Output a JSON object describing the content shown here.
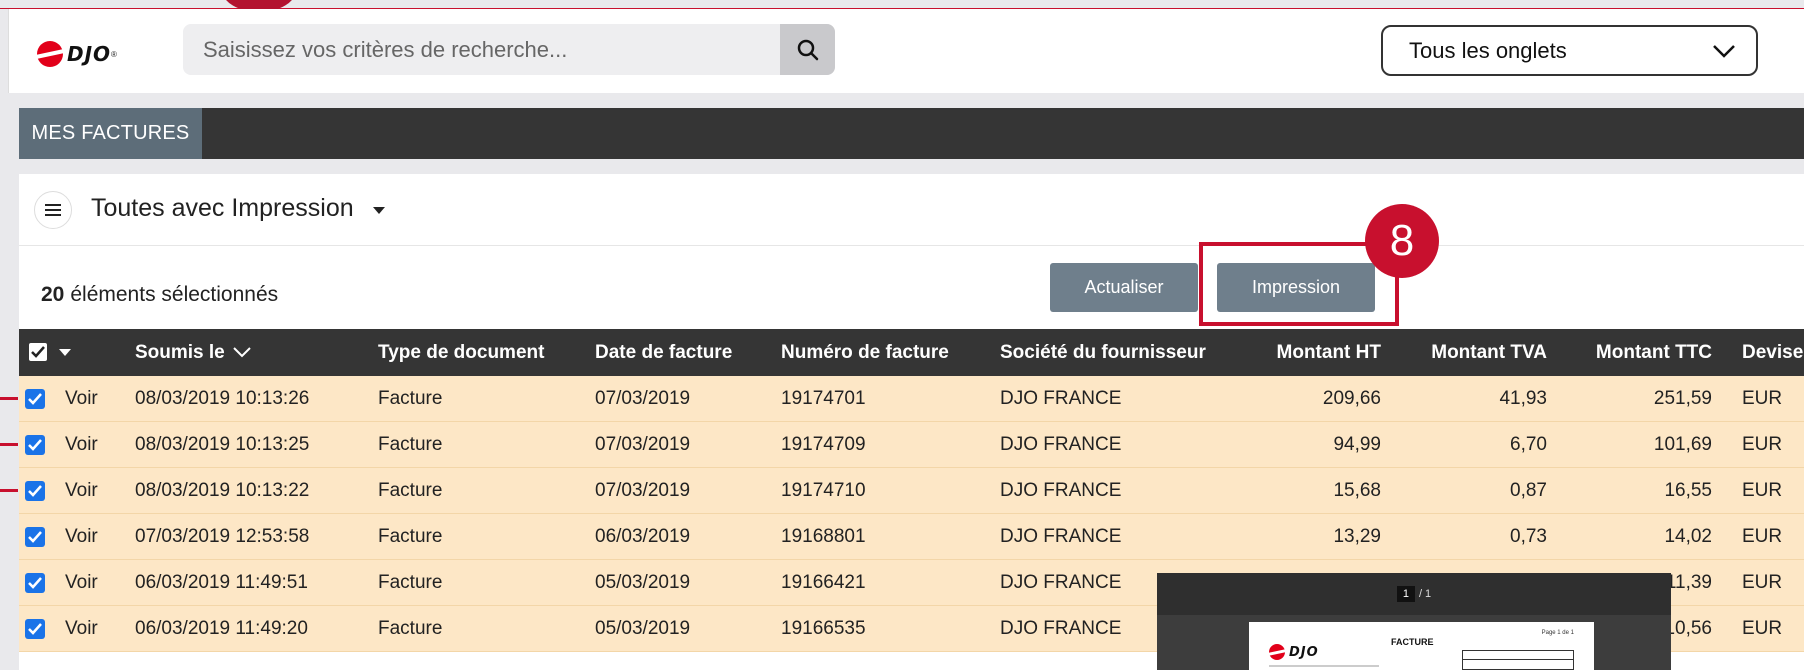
{
  "header": {
    "logo_text": "DJO",
    "search_placeholder": "Saisissez vos critères de recherche...",
    "tab_filter": "Tous les onglets"
  },
  "tabs": [
    {
      "label": "MES FACTURES"
    }
  ],
  "view": {
    "label": "Toutes avec Impression"
  },
  "selection": {
    "count": "20",
    "label": "éléments sélectionnés"
  },
  "buttons": {
    "refresh": "Actualiser",
    "print": "Impression"
  },
  "annotation": {
    "badge": "8"
  },
  "table": {
    "columns": {
      "submitted": "Soumis le",
      "doc_type": "Type de document",
      "invoice_date": "Date de facture",
      "invoice_number": "Numéro de facture",
      "supplier": "Société du fournisseur",
      "amount_ht": "Montant HT",
      "amount_tva": "Montant TVA",
      "amount_ttc": "Montant TTC",
      "currency": "Devise"
    },
    "rows": [
      {
        "view": "Voir",
        "submitted": "08/03/2019 10:13:26",
        "doc_type": "Facture",
        "invoice_date": "07/03/2019",
        "invoice_number": "19174701",
        "supplier": "DJO FRANCE",
        "ht": "209,66",
        "tva": "41,93",
        "ttc": "251,59",
        "currency": "EUR"
      },
      {
        "view": "Voir",
        "submitted": "08/03/2019 10:13:25",
        "doc_type": "Facture",
        "invoice_date": "07/03/2019",
        "invoice_number": "19174709",
        "supplier": "DJO FRANCE",
        "ht": "94,99",
        "tva": "6,70",
        "ttc": "101,69",
        "currency": "EUR"
      },
      {
        "view": "Voir",
        "submitted": "08/03/2019 10:13:22",
        "doc_type": "Facture",
        "invoice_date": "07/03/2019",
        "invoice_number": "19174710",
        "supplier": "DJO FRANCE",
        "ht": "15,68",
        "tva": "0,87",
        "ttc": "16,55",
        "currency": "EUR"
      },
      {
        "view": "Voir",
        "submitted": "07/03/2019 12:53:58",
        "doc_type": "Facture",
        "invoice_date": "06/03/2019",
        "invoice_number": "19168801",
        "supplier": "DJO FRANCE",
        "ht": "13,29",
        "tva": "0,73",
        "ttc": "14,02",
        "currency": "EUR"
      },
      {
        "view": "Voir",
        "submitted": "06/03/2019 11:49:51",
        "doc_type": "Facture",
        "invoice_date": "05/03/2019",
        "invoice_number": "19166421",
        "supplier": "DJO FRANCE",
        "ht": "",
        "tva": "",
        "ttc": "11,39",
        "currency": "EUR"
      },
      {
        "view": "Voir",
        "submitted": "06/03/2019 11:49:20",
        "doc_type": "Facture",
        "invoice_date": "05/03/2019",
        "invoice_number": "19166535",
        "supplier": "DJO FRANCE",
        "ht": "",
        "tva": "",
        "ttc": "10,56",
        "currency": "EUR"
      }
    ]
  },
  "pdf_preview": {
    "page_current": "1",
    "page_total": "/ 1",
    "title": "FACTURE",
    "page_info": "Page 1 de 1"
  },
  "colors": {
    "accent_red": "#c8102e",
    "row_highlight": "#fde7c6",
    "button_gray": "#6f7f8c",
    "header_dark": "#353535"
  }
}
